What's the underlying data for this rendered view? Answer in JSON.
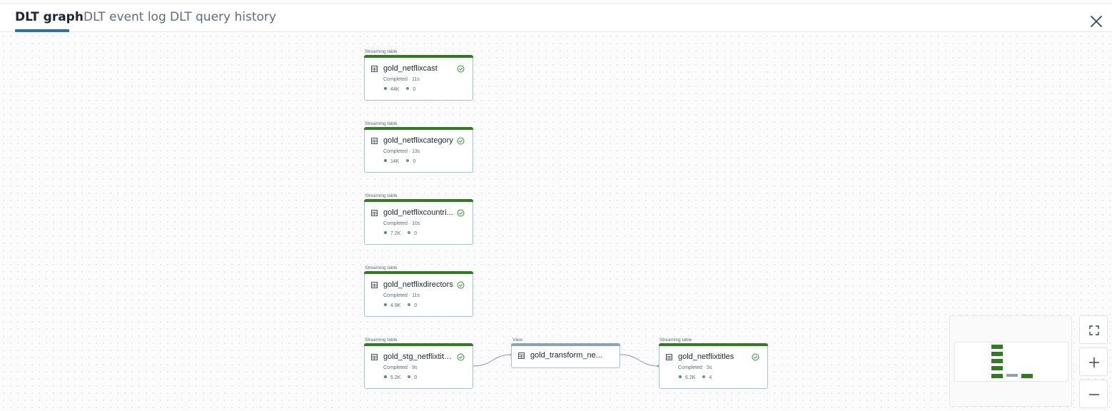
{
  "tabs": [
    {
      "label": "DLT graph",
      "active": true
    },
    {
      "label": "DLT event log",
      "active": false
    },
    {
      "label": "DLT query history",
      "active": false
    }
  ],
  "colors": {
    "accent": "#2272b4",
    "success": "#2f7d1e",
    "view_bar": "#8aa2b8",
    "node_border": "#9dc3e2"
  },
  "nodes": [
    {
      "type": "Streaming table",
      "name": "gold_netflixcast",
      "status": "Completed · 11s",
      "rows": "44K",
      "dropped": "0"
    },
    {
      "type": "Streaming table",
      "name": "gold_netflixcategory",
      "status": "Completed · 13s",
      "rows": "14K",
      "dropped": "0"
    },
    {
      "type": "Streaming table",
      "name": "gold_netflixcountri...",
      "status": "Completed · 10s",
      "rows": "7.2K",
      "dropped": "0"
    },
    {
      "type": "Streaming table",
      "name": "gold_netflixdirectors",
      "status": "Completed · 11s",
      "rows": "4.9K",
      "dropped": "0"
    },
    {
      "type": "Streaming table",
      "name": "gold_stg_netflixtitles",
      "status": "Completed · 9s",
      "rows": "6.2K",
      "dropped": "0"
    },
    {
      "type": "View",
      "name": "gold_transform_ne..."
    },
    {
      "type": "Streaming table",
      "name": "gold_netflixtitles",
      "status": "Completed · 5s",
      "rows": "6.2K",
      "dropped": "4"
    }
  ],
  "icons": {
    "close": "close-icon",
    "table": "table-icon",
    "check": "check-circle-icon",
    "fit": "fit-view-icon",
    "zoom_in": "zoom-in-icon",
    "zoom_out": "zoom-out-icon"
  }
}
